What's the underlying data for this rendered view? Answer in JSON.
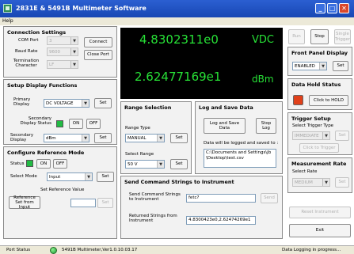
{
  "window": {
    "title": "2831E & 5491B Multimeter Software"
  },
  "menu": {
    "help": "Help"
  },
  "connection": {
    "title": "Connection Settings",
    "com_port_label": "COM Port",
    "com_port_value": "3",
    "baud_rate_label": "Baud Rate",
    "baud_rate_value": "9600",
    "termination_label": "Termination Character",
    "termination_value": "LF",
    "connect_label": "Connect",
    "close_port_label": "Close Port"
  },
  "setup_display": {
    "title": "Setup Display Functions",
    "primary_label": "Primary Display",
    "primary_value": "DC VOLTAGE",
    "set_label": "Set",
    "secondary_status_label": "Secondary Display Status",
    "on_label": "ON",
    "off_label": "OFF",
    "secondary_label": "Secondary Display",
    "secondary_value": "dBm"
  },
  "reference": {
    "title": "Configure Reference Mode",
    "status_label": "Status",
    "on_label": "ON",
    "off_label": "OFF",
    "select_mode_label": "Select Mode",
    "select_mode_value": "Input",
    "set_label": "Set",
    "set_ref_value_label": "Set Reference Value",
    "ref_from_input_label": "Reference Set from Input",
    "ref_value": "",
    "set2_label": "Set"
  },
  "display": {
    "primary_value": "4.8302311e0",
    "primary_unit": "VDC",
    "secondary_value": "2.62477169e1",
    "secondary_unit": "dBm"
  },
  "range": {
    "title": "Range Selection",
    "range_type_label": "Range Type",
    "range_type_value": "MANUAL",
    "set_label": "Set",
    "select_range_label": "Select Range",
    "select_range_value": "50 V",
    "set2_label": "Set"
  },
  "log": {
    "title": "Log and Save Data",
    "log_save_label": "Log and Save Data",
    "stop_log_label": "Stop Log",
    "note": "Data will be logged and saved to :",
    "path": "C:\\Documents and Settings\\jb\\Desktop\\test.csv"
  },
  "send": {
    "title": "Send Command Strings to Instrument",
    "send_label": "Send Command Strings to Instrument",
    "command_value": "fetc?",
    "send_button": "Send",
    "returned_label": "Returned Strings from Instrument",
    "returned_value": "4.8300423e0,2.62474269e1"
  },
  "controls": {
    "run_label": "Run",
    "stop_label": "Stop",
    "single_label": "Single Trigger"
  },
  "front_panel": {
    "title": "Front Panel Display",
    "value": "ENABLED",
    "set_label": "Set"
  },
  "data_hold": {
    "title": "Data Hold Status",
    "click_hold_label": "Click to HOLD"
  },
  "trigger": {
    "title": "Trigger Setup",
    "select_label": "Select Trigger Type",
    "value": "IMMEDIATE",
    "set_label": "Set",
    "click_trigger_label": "Click to Trigger"
  },
  "measurement": {
    "title": "Measurement Rate",
    "select_rate_label": "Select Rate",
    "value": "MEDIUM",
    "set_label": "Set"
  },
  "bottom_buttons": {
    "reset_label": "Reset Instrument",
    "exit_label": "Exit"
  },
  "status_bar": {
    "port_status_label": "Port Status",
    "model_version": "5491B Multimeter,Ver1.0.10.03.17",
    "logging_status": "Data Logging in progress..."
  },
  "colors": {
    "titlebar": "#1f4fc3",
    "display_bg": "#000000",
    "display_text": "#27e036",
    "led_green": "#22bb44",
    "led_red": "#e0401a"
  }
}
